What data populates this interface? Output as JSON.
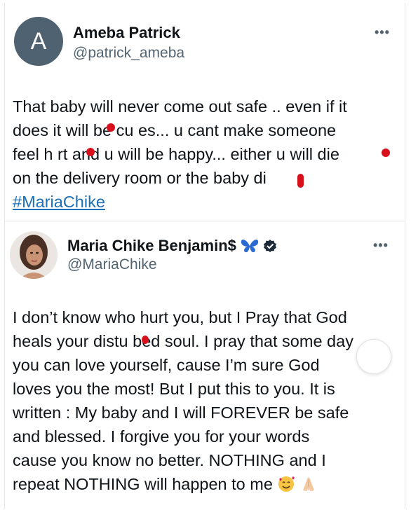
{
  "tweet1": {
    "avatar_letter": "A",
    "name": "Ameba Patrick",
    "handle": "@patrick_ameba",
    "more": "•••",
    "lines": [
      "That baby will never come out safe .. even if it",
      "does it will be cu es... u cant make someone",
      "feel h rt and u will be happy... either u will die",
      "on the delivery room or the baby di"
    ],
    "hashtag": "#MariaChike"
  },
  "tweet2": {
    "name": "Maria Chike Benjamin$",
    "handle": "@MariaChike",
    "more": "•••",
    "lines": [
      "I don’t know who hurt you, but I Pray that God",
      "heals your distu bed soul. I pray that some day",
      "you can love yourself, cause I’m sure God",
      "loves you the most! But I put this to you. It is",
      "written : My baby and I will FOREVER be safe",
      "and blessed. I forgive you for your words",
      "cause you know no better. NOTHING and I",
      "repeat NOTHING will happen to me"
    ],
    "emojis": [
      "smiling-face-with-hearts",
      "folded-hands"
    ]
  },
  "colors": {
    "text": "#0f1419",
    "secondary": "#536471",
    "link": "#1d6fb8",
    "avatar_bg": "#4f6271",
    "verified": "#1d2b3a",
    "redaction": "#d8101c"
  }
}
